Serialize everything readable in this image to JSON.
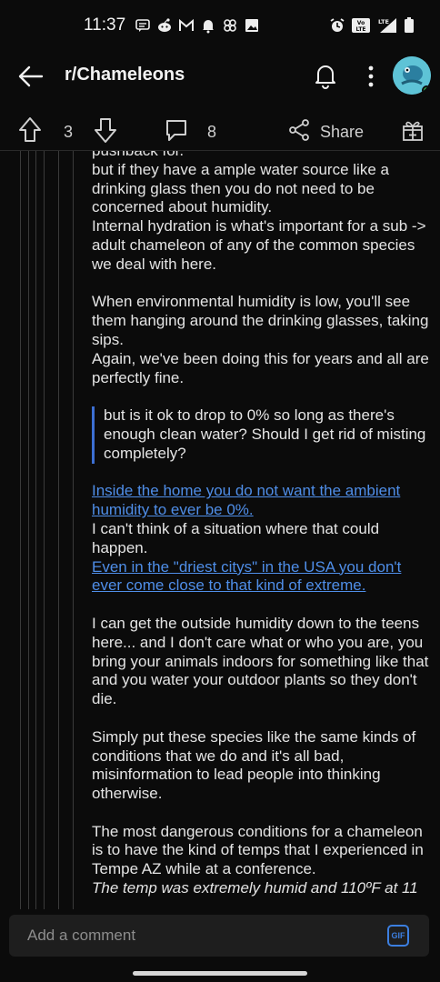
{
  "status_bar": {
    "time": "11:37",
    "left_icons": [
      "message-icon",
      "reddit-icon",
      "gmail-icon",
      "bell-icon",
      "pinwheel-icon",
      "image-icon"
    ],
    "right_icons": [
      "alarm-icon",
      "volte-icon",
      "lte-signal-icon",
      "battery-icon"
    ],
    "volte_label": "Vo LTE",
    "lte_label": "LTE"
  },
  "app_bar": {
    "subreddit": "r/Chameleons",
    "avatar_color": "#5ec3d6",
    "online_color": "#3cc34a"
  },
  "action_bar": {
    "upvotes": "3",
    "comments": "8",
    "share_label": "Share"
  },
  "comment": {
    "p1_cut": "pushback for.",
    "p1": "but if they have a ample water source like a drinking glass then you do not need to be concerned about humidity.",
    "p2": "Internal hydration is what's important for a sub -> adult chameleon of any of the common species we deal with here.",
    "p3": "When environmental humidity is low, you'll see them hanging around the drinking glasses, taking sips.",
    "p4": "Again, we've been doing this for years and all are perfectly fine.",
    "quote": "but is it ok to drop to 0% so long as there's enough clean water? Should I get rid of misting completely?",
    "link1": "Inside the home you do not want the ambient humidity to ever be 0%.",
    "p5": "I can't think of a situation where that could happen.",
    "link2": "Even in the \"driest citys\" in the USA you don't ever come close to that kind of extreme.",
    "p6": "I can get the outside humidity down to the teens here... and I don't care what or who you are, you bring your animals indoors for something like that and you water your outdoor plants so they don't die.",
    "p7": "Simply put these species like the same kinds of conditions that we do and it's all bad, misinformation to lead people into thinking otherwise.",
    "p8": "The most dangerous conditions for a chameleon is to have the kind of temps that I experienced in Tempe AZ while at a conference.",
    "p8_italic": "The temp was extremely humid and 110ºF at 11"
  },
  "composer": {
    "placeholder": "Add a comment",
    "gif_label": "GIF"
  },
  "colors": {
    "background": "#0b0b0b",
    "link": "#4f8ee8",
    "quote_bar": "#3c6fd3"
  }
}
